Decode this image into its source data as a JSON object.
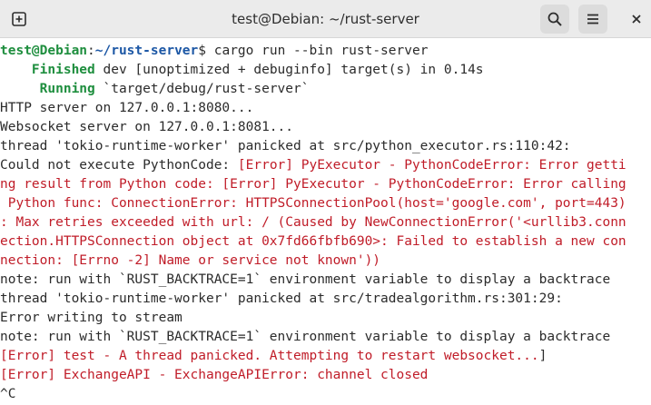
{
  "window": {
    "title": "test@Debian: ~/rust-server",
    "new_tab_icon": "new-tab-icon",
    "search_icon": "search-icon",
    "menu_icon": "hamburger-menu-icon",
    "close_icon": "close-icon"
  },
  "terminal": {
    "prompt": {
      "user_host": "test@Debian",
      "sep": ":",
      "path": "~/rust-server",
      "dollar": "$",
      "command": " cargo run --bin rust-server"
    },
    "finished": {
      "label": "    Finished",
      "text": " dev [unoptimized + debuginfo] target(s) in 0.14s"
    },
    "running": {
      "label": "     Running",
      "text": " `target/debug/rust-server`"
    },
    "lines": [
      "HTTP server on 127.0.0.1:8080...",
      "Websocket server on 127.0.0.1:8081...",
      "thread 'tokio-runtime-worker' panicked at src/python_executor.rs:110:42:"
    ],
    "could_not": {
      "plain": "Could not execute PythonCode: ",
      "red": "[Error] PyExecutor - PythonCodeError: Error getti"
    },
    "error_wrap": [
      "ng result from Python code: [Error] PyExecutor - PythonCodeError: Error calling",
      " Python func: ConnectionError: HTTPSConnectionPool(host='google.com', port=443)",
      ": Max retries exceeded with url: / (Caused by NewConnectionError('<urllib3.conn",
      "ection.HTTPSConnection object at 0x7fd66fbfb690>: Failed to establish a new con",
      "nection: [Errno -2] Name or service not known'))"
    ],
    "after": [
      "note: run with `RUST_BACKTRACE=1` environment variable to display a backtrace",
      "thread 'tokio-runtime-worker' panicked at src/tradealgorithm.rs:301:29:",
      "Error writing to stream",
      "note: run with `RUST_BACKTRACE=1` environment variable to display a backtrace"
    ],
    "ws_error": {
      "red": "[Error] test - A thread panicked. Attempting to restart websocket...",
      "plain": "]"
    },
    "exchange_error": "[Error] ExchangeAPI - ExchangeAPIError: channel closed",
    "ctrl_c": "^C"
  }
}
